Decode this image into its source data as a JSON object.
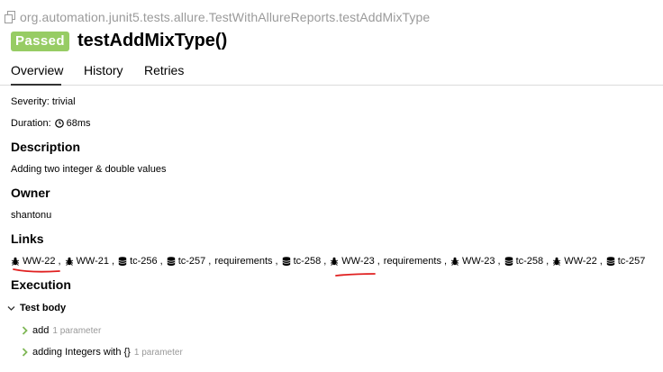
{
  "header": {
    "path": "org.automation.junit5.tests.allure.TestWithAllureReports.testAddMixType",
    "status_badge": "Passed",
    "title": "testAddMixType()"
  },
  "tabs": [
    {
      "label": "Overview",
      "active": true
    },
    {
      "label": "History",
      "active": false
    },
    {
      "label": "Retries",
      "active": false
    }
  ],
  "overview": {
    "severity": "Severity: trivial",
    "duration_label": "Duration:",
    "duration_value": "68ms",
    "description_header": "Description",
    "description_text": "Adding two integer & double values",
    "owner_header": "Owner",
    "owner_text": "shantonu",
    "links_header": "Links",
    "links": [
      {
        "icon": "bug-icon",
        "label": "WW-22"
      },
      {
        "icon": "bug-icon",
        "label": "WW-21"
      },
      {
        "icon": "database-icon",
        "label": "tc-256"
      },
      {
        "icon": "database-icon",
        "label": "tc-257"
      },
      {
        "icon": "none",
        "label": "requirements"
      },
      {
        "icon": "database-icon",
        "label": "tc-258"
      },
      {
        "icon": "bug-icon",
        "label": "WW-23"
      },
      {
        "icon": "none",
        "label": "requirements"
      },
      {
        "icon": "bug-icon",
        "label": "WW-23"
      },
      {
        "icon": "database-icon",
        "label": "tc-258"
      },
      {
        "icon": "bug-icon",
        "label": "WW-22"
      },
      {
        "icon": "database-icon",
        "label": "tc-257"
      }
    ],
    "execution_header": "Execution",
    "test_body_label": "Test body",
    "steps": [
      {
        "label": "add",
        "param": "1 parameter"
      },
      {
        "label": "adding Integers with {}",
        "param": "1 parameter"
      }
    ]
  },
  "colors": {
    "passed_badge": "#97cc64",
    "annotation_red": "#e02020",
    "step_chevron": "#7fb755"
  }
}
